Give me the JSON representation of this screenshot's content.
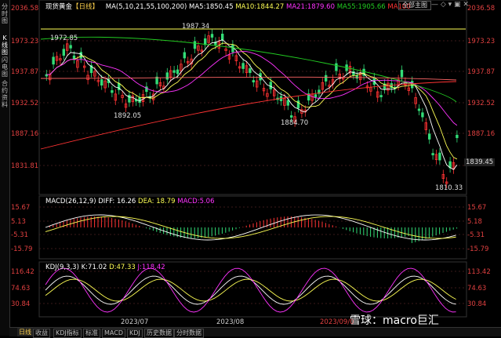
{
  "side_tabs": [
    "分时图",
    "K线图",
    "闪电图",
    "合约资料"
  ],
  "legend_main": {
    "name": "现货黄金",
    "period": "【日线】",
    "ma_label": "MA(5,10,21,55,100,200)",
    "ma5": "MA5:1850.45",
    "ma10": "MA10:1844.27",
    "ma21": "MA21:1879.60",
    "ma55": "MA55:1905.66",
    "ma100": "MA100",
    "button": "全部主图"
  },
  "left_axis": [
    "2036.58",
    "1973.23",
    "1937.87",
    "1932.52",
    "1887.16",
    "1831.81",
    "15.67",
    "5.13",
    "-5.31",
    "-15.79",
    "116.42",
    "74.63",
    "30.84"
  ],
  "right_axis": [
    "2036.58",
    "1973.23",
    "1937.87",
    "1932.52",
    "1887.16",
    "1839.45",
    "15.67",
    "5.18",
    "-5.31",
    "-15.79",
    "113.42",
    "74.63",
    "30.84"
  ],
  "current_price": "1839.45",
  "peaks": {
    "p1": "1972.85",
    "p2": "1987.34",
    "p3": "1892.05",
    "p4": "1884.70",
    "p5": "1810.33"
  },
  "legend_macd": {
    "label": "MACD(26,12,9)",
    "diff": "DIFF: 16.26",
    "dea": "DEA: 18.79",
    "macd": "MACD:5.06"
  },
  "legend_kdj": {
    "label": "KDJ(9,3,3)",
    "k": "K:71.02",
    "d": "D:47.33",
    "j": "J:118.42"
  },
  "x_axis": [
    "2023/07",
    "2023/08",
    "2023/09/0"
  ],
  "period_tab": "日线",
  "toolbar": [
    "收益",
    "KDJ指标",
    "标准",
    "MACD",
    "KDJ",
    "历史数据",
    "分时数据"
  ],
  "watermark": "雪球：macro巨汇",
  "colors": {
    "up": "#ff3333",
    "down": "#33dd77",
    "ma5": "#ffffff",
    "ma10": "#ffff55",
    "ma21": "#ff33ff",
    "ma55": "#22cc22",
    "ma100": "#ff3333",
    "axis_text": "#e04040"
  }
}
